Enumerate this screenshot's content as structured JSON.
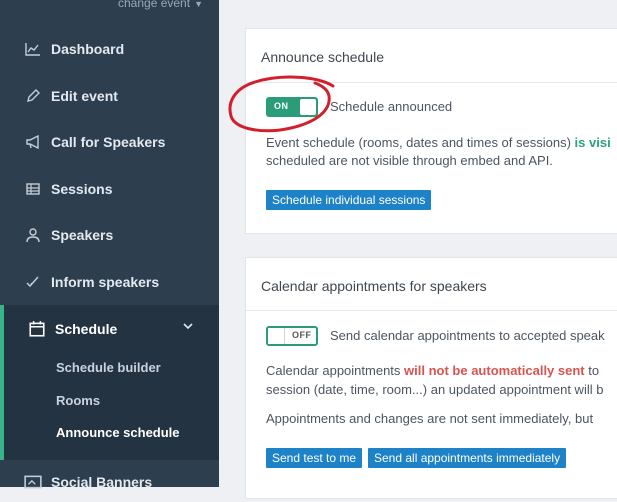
{
  "sidebar": {
    "event_switch": "change event",
    "items": [
      {
        "label": "Dashboard",
        "icon": "chart-icon"
      },
      {
        "label": "Edit event",
        "icon": "pencil-icon"
      },
      {
        "label": "Call for Speakers",
        "icon": "megaphone-icon"
      },
      {
        "label": "Sessions",
        "icon": "table-icon"
      },
      {
        "label": "Speakers",
        "icon": "user-icon"
      },
      {
        "label": "Inform speakers",
        "icon": "check-icon"
      }
    ],
    "schedule": {
      "label": "Schedule",
      "icon": "calendar-icon",
      "children": [
        "Schedule builder",
        "Rooms",
        "Announce schedule"
      ]
    },
    "social_banners": "Social Banners"
  },
  "announce": {
    "title": "Announce schedule",
    "toggle_label": "ON",
    "toggle_text": "Schedule announced",
    "desc_line1_a": "Event schedule (rooms, dates and times of sessions) ",
    "desc_line1_b": "is visi",
    "desc_line2": "scheduled are not visible through embed and API.",
    "button": "Schedule individual sessions"
  },
  "calendar": {
    "title": "Calendar appointments for speakers",
    "toggle_label": "OFF",
    "toggle_text": "Send calendar appointments to accepted speak",
    "line1_a": "Calendar appointments ",
    "line1_b": "will not be automatically sent",
    "line1_c": " to",
    "line2": "session (date, time, room...) an updated appointment will b",
    "line3": "Appointments and changes are not sent immediately, but",
    "button1": "Send test to me",
    "button2": "Send all appointments immediately"
  },
  "colors": {
    "sidebar": "#2d3e4f",
    "accent": "#38b48b",
    "toggle": "#2a9d78",
    "button": "#1e82c9",
    "annotation": "#d21f2b"
  }
}
